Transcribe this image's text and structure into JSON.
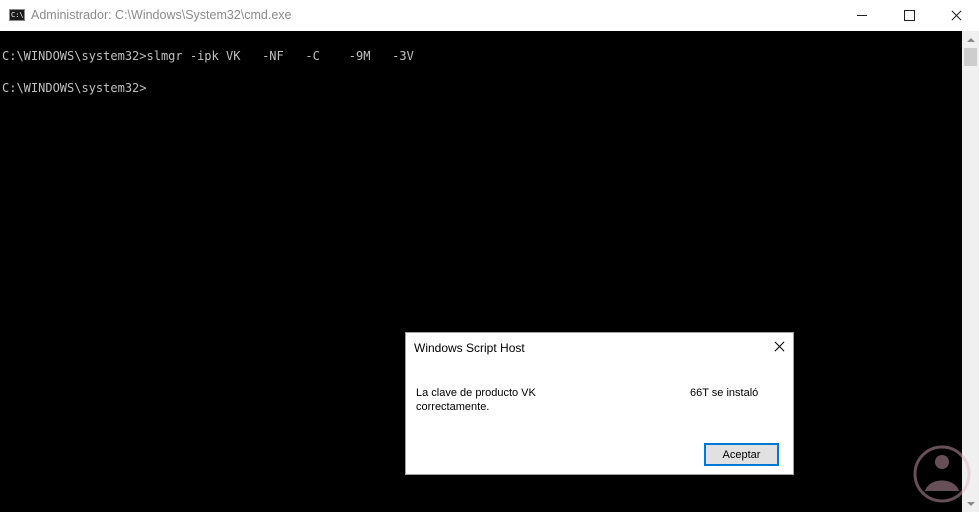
{
  "window": {
    "title": "Administrador: C:\\Windows\\System32\\cmd.exe",
    "icon": "cmd-icon",
    "icon_glyph": "C:\\"
  },
  "console": {
    "lines": [
      "C:\\WINDOWS\\system32>slmgr -ipk VK   -NF   -C    -9M   -3V",
      "C:\\WINDOWS\\system32>"
    ],
    "background": "#000000",
    "text_color": "#c0c0c0"
  },
  "dialog": {
    "title": "Windows Script Host",
    "message_part1": "La clave de producto VK",
    "message_part2": "66T se instaló",
    "message_line2": "correctamente.",
    "ok_label": "Aceptar",
    "accent": "#0078d7"
  },
  "watermark": {
    "icon": "person-logo-icon"
  }
}
